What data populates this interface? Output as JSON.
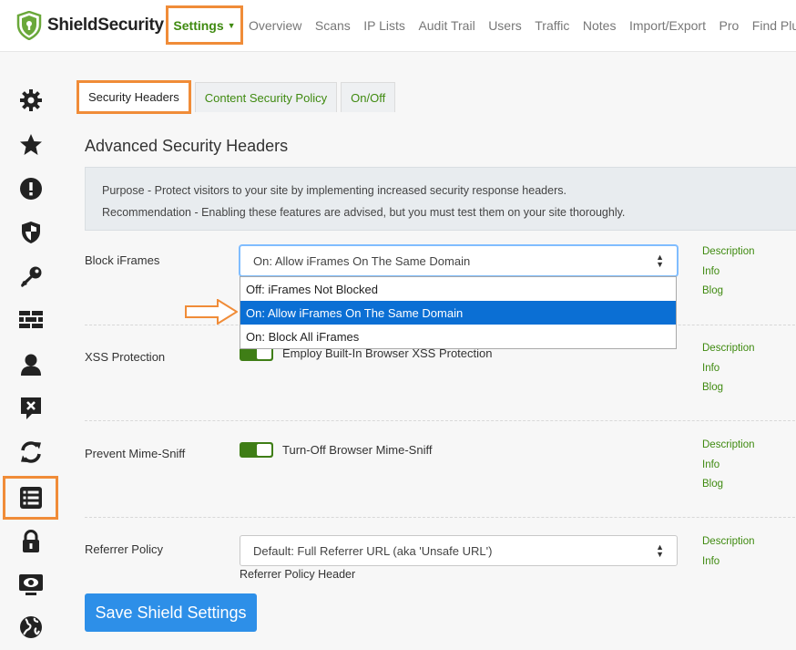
{
  "brand": {
    "name": "ShieldSecurity"
  },
  "nav": {
    "settings": "Settings",
    "items": [
      "Overview",
      "Scans",
      "IP Lists",
      "Audit Trail",
      "Users",
      "Traffic",
      "Notes",
      "Import/Export",
      "Pro",
      "Find Plugi"
    ]
  },
  "sidebar": {
    "icons": [
      "gear-icon",
      "star-icon",
      "alert-icon",
      "shield-icon",
      "key-icon",
      "firewall-icon",
      "user-icon",
      "comment-x-icon",
      "sync-icon",
      "list-icon",
      "lock-icon",
      "monitor-eye-icon",
      "globe-icon"
    ],
    "active": "list-icon"
  },
  "tabs": [
    "Security Headers",
    "Content Security Policy",
    "On/Off"
  ],
  "section": {
    "title": "Advanced Security Headers",
    "purpose": "Purpose - Protect visitors to your site by implementing increased security response headers.",
    "recommendation": "Recommendation - Enabling these features are advised, but you must test them on your site thoroughly."
  },
  "options": {
    "block_iframes": {
      "label": "Block iFrames",
      "selected": "On: Allow iFrames On The Same Domain",
      "choices": [
        "Off: iFrames Not Blocked",
        "On: Allow iFrames On The Same Domain",
        "On: Block All iFrames"
      ],
      "links": [
        "Description",
        "Info",
        "Blog"
      ]
    },
    "xss": {
      "label": "XSS Protection",
      "toggle_label": "Employ Built-In Browser XSS Protection",
      "links": [
        "Description",
        "Info",
        "Blog"
      ]
    },
    "mime": {
      "label": "Prevent Mime-Sniff",
      "toggle_label": "Turn-Off Browser Mime-Sniff",
      "links": [
        "Description",
        "Info",
        "Blog"
      ]
    },
    "referrer": {
      "label": "Referrer Policy",
      "selected": "Default: Full Referrer URL (aka 'Unsafe URL')",
      "sub_label": "Referrer Policy Header",
      "links": [
        "Description",
        "Info"
      ]
    }
  },
  "save_button": "Save Shield Settings",
  "colors": {
    "accent_green": "#3f8a10",
    "highlight_orange": "#f08c38",
    "primary_blue": "#2d8fe8",
    "selected_option": "#0b6fd4"
  }
}
